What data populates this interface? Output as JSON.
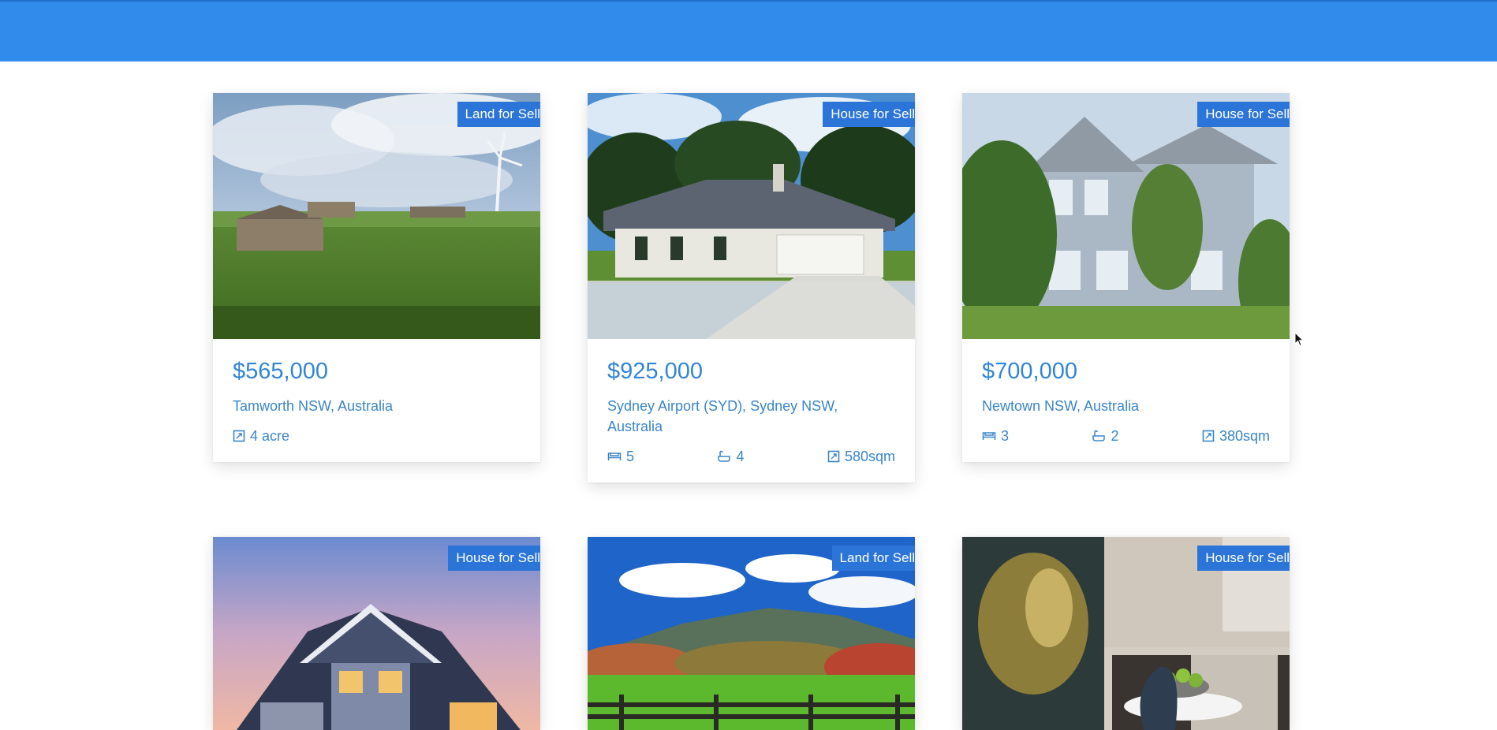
{
  "colors": {
    "topbar": "#318bea",
    "badge": "#2b74d8",
    "price": "#3185d8",
    "text": "#3a86c9"
  },
  "listings": [
    {
      "badge": "Land for Sell",
      "price": "$565,000",
      "address": "Tamworth NSW, Australia",
      "area": "4 acre",
      "image": "farm-landscape-with-wind-turbine"
    },
    {
      "badge": "House for Sell",
      "price": "$925,000",
      "address": "Sydney Airport (SYD), Sydney NSW, Australia",
      "beds": "5",
      "baths": "4",
      "area": "580sqm",
      "image": "single-story-house-with-driveway"
    },
    {
      "badge": "House for Sell",
      "price": "$700,000",
      "address": "Newtown NSW, Australia",
      "beds": "3",
      "baths": "2",
      "area": "380sqm",
      "image": "two-story-grey-house-with-garden"
    },
    {
      "badge": "House for Sell",
      "image": "blue-house-at-sunset"
    },
    {
      "badge": "Land for Sell",
      "image": "mountain-field-with-fence"
    },
    {
      "badge": "House for Sell",
      "image": "modern-kitchen-interior"
    }
  ]
}
